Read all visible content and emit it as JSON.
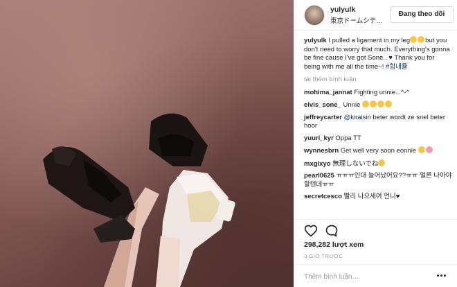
{
  "post": {
    "username": "yulyulk",
    "location": "東京ドームシテ…",
    "follow_button": "Đang theo dõi",
    "caption": {
      "username": "yulyulk",
      "text_1": "I pulled a ligament in my leg",
      "text_2": "but you don't need to worry that much. Everything's gonna be fine cause I've got Sone.. ♥ Thank you for being with me all the time~! ",
      "hashtag": "#힘내율"
    },
    "load_more": "tải thêm bình luận",
    "comments": [
      {
        "user": "mohima_jannat",
        "text": "Fighting unnie...^-^"
      },
      {
        "user": "elvis_sone_",
        "text": "Unnie"
      },
      {
        "user": "jeffreycarter",
        "mention": "@kiraisin",
        "text": " beter wordt ze snel beter hoor"
      },
      {
        "user": "yuuri_kyr",
        "text": "Oppa TT"
      },
      {
        "user": "wynnesbrn",
        "text": "Get well very soon eonnie"
      },
      {
        "user": "mxglxyo",
        "text": "無理しないでね"
      },
      {
        "user": "pearl0625",
        "text": "ㅠㅠㅠ인대 늘어났어요??ㅠㅠ 얼른 나아야할텐데ㅠㅠ"
      },
      {
        "user": "secretcesco",
        "text": "빨리 나으세여 언니♥"
      }
    ],
    "views": "298,282 lượt xem",
    "time_ago": "3 GIỜ TRƯỚC",
    "add_comment_placeholder": "Thêm bình luận…"
  },
  "icons": {
    "like": "heart-icon",
    "comment": "comment-bubble-icon",
    "more": "more-options-icon",
    "emoji": "emoji-icon"
  },
  "colors": {
    "link": "#003569",
    "muted": "#999999",
    "text": "#262626",
    "border": "#efefef"
  }
}
